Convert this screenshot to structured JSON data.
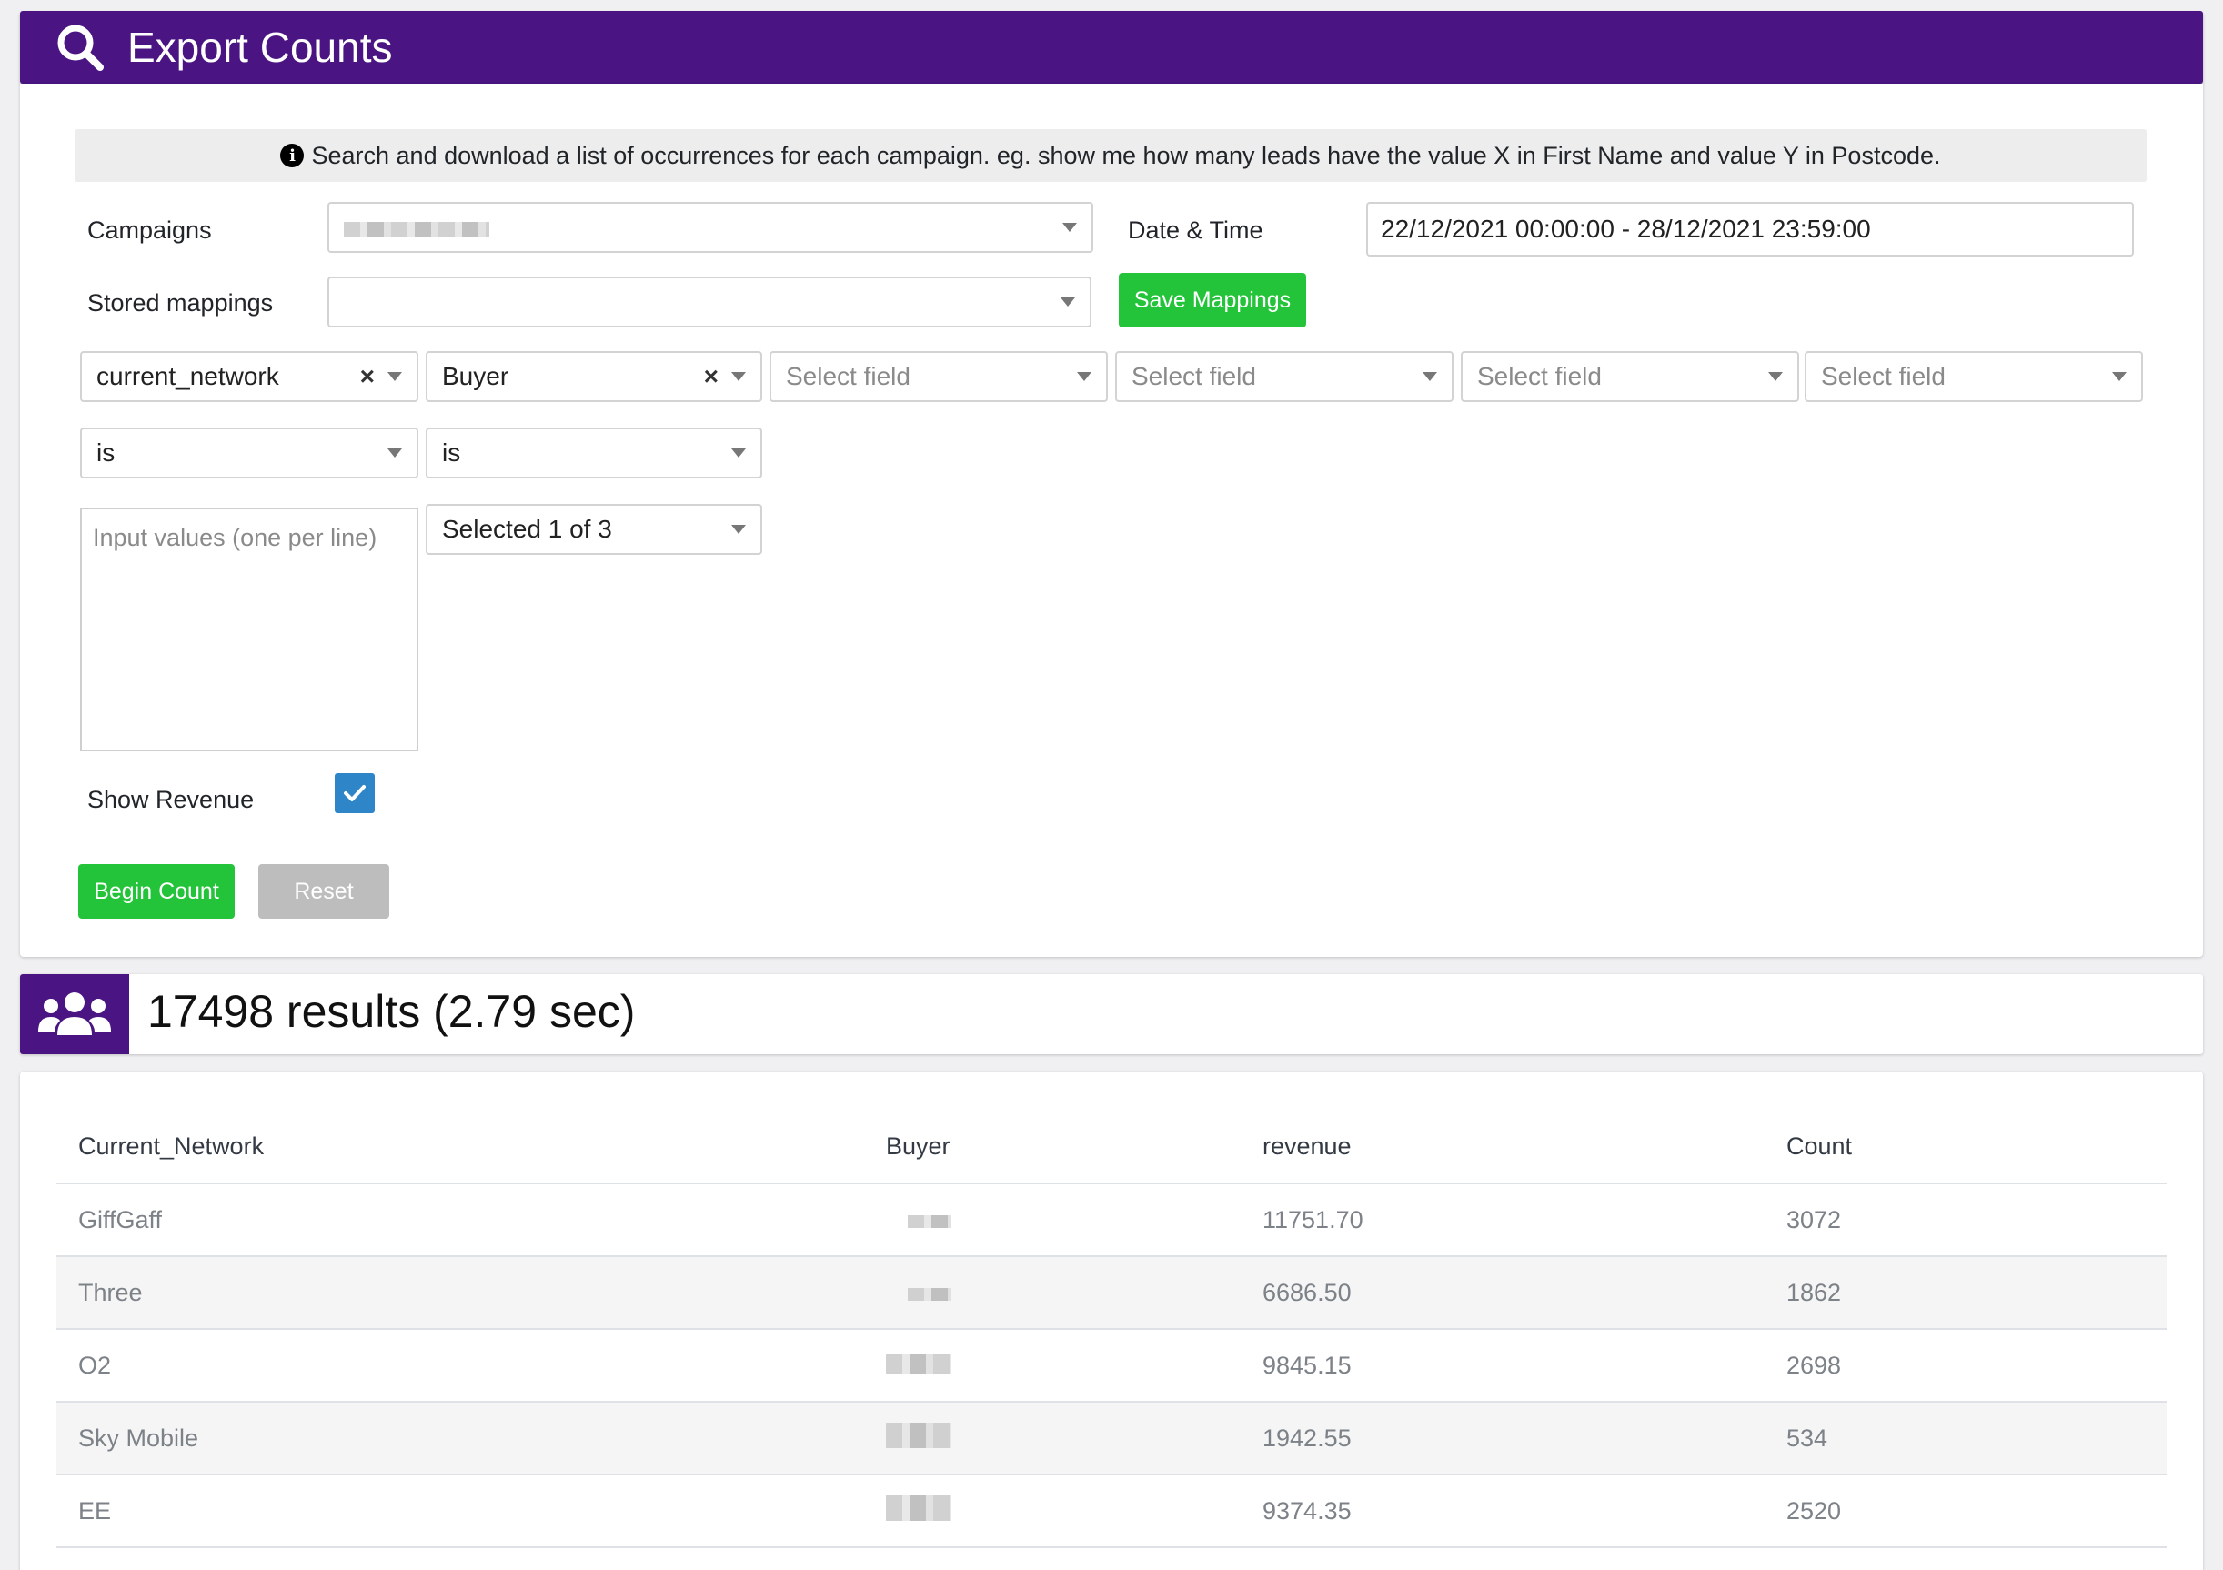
{
  "header": {
    "title": "Export Counts",
    "icon": "search-icon"
  },
  "info": {
    "text": "Search and download a list of occurrences for each campaign. eg. show me how many leads have the value X in First Name and value Y in Postcode."
  },
  "form": {
    "campaigns_label": "Campaigns",
    "datetime_label": "Date & Time",
    "datetime_value": "22/12/2021 00:00:00 - 28/12/2021 23:59:00",
    "stored_mappings_label": "Stored mappings",
    "save_mappings_label": "Save Mappings",
    "fields": [
      {
        "value": "current_network",
        "clearable": true
      },
      {
        "value": "Buyer",
        "clearable": true
      },
      {
        "placeholder": "Select field"
      },
      {
        "placeholder": "Select field"
      },
      {
        "placeholder": "Select field"
      },
      {
        "placeholder": "Select field"
      }
    ],
    "operators": [
      "is",
      "is"
    ],
    "textarea_placeholder": "Input values (one per line)",
    "multi_select_value": "Selected 1 of 3",
    "show_revenue_label": "Show Revenue",
    "show_revenue_checked": true,
    "begin_count_label": "Begin Count",
    "reset_label": "Reset"
  },
  "results": {
    "summary": "17498 results (2.79 sec)",
    "icon": "users-icon",
    "columns": [
      "Current_Network",
      "Buyer",
      "revenue",
      "Count"
    ],
    "rows": [
      {
        "network": "GiffGaff",
        "revenue": "11751.70",
        "count": "3072"
      },
      {
        "network": "Three",
        "revenue": "6686.50",
        "count": "1862"
      },
      {
        "network": "O2",
        "revenue": "9845.15",
        "count": "2698"
      },
      {
        "network": "Sky Mobile",
        "revenue": "1942.55",
        "count": "534"
      },
      {
        "network": "EE",
        "revenue": "9374.35",
        "count": "2520"
      }
    ]
  },
  "colors": {
    "brand": "#4a1582",
    "success": "#24c43a",
    "checkbox": "#2e86c8"
  }
}
